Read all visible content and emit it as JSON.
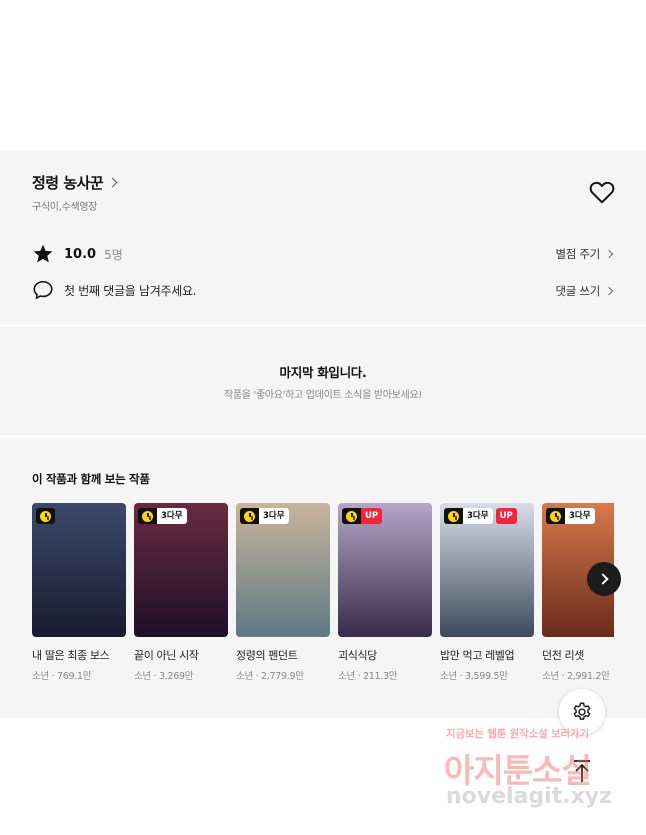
{
  "work": {
    "title": "정령 농사꾼",
    "authors": "구식이,수색영장",
    "rating": "10.0",
    "rating_count": "5명",
    "rate_link": "별점 주기",
    "comment_prompt": "첫 번째 댓글을 남겨주세요.",
    "comment_link": "댓글 쓰기"
  },
  "last_episode": {
    "title": "마지막 화입니다.",
    "subtitle": "작품을 '좋아요'하고 업데이트 소식을 받아보세요!"
  },
  "recommendations": {
    "heading": "이 작품과 함께 보는 작품",
    "items": [
      {
        "title": "내 딸은 최종 보스",
        "meta": "소년 · 769.1만",
        "badge": "",
        "bg_top": "#3a4a6a",
        "bg_bottom": "#1a1a2e"
      },
      {
        "title": "끝이 아닌 시작",
        "meta": "소년 · 3,269만",
        "badge": "3다무",
        "bg_top": "#6a2a40",
        "bg_bottom": "#1c1028"
      },
      {
        "title": "정령의 펜던트",
        "meta": "소년 · 2,779.9만",
        "badge": "3다무",
        "bg_top": "#c8b49a",
        "bg_bottom": "#5d7a86"
      },
      {
        "title": "괴식식당",
        "meta": "소년 · 211.3만",
        "badge": "UP",
        "bg_top": "#b4a6c8",
        "bg_bottom": "#3a2a4a"
      },
      {
        "title": "밥만 먹고 레벨업",
        "meta": "소년 · 3,599.5만",
        "badge2": "UP",
        "badge": "3다무",
        "bg_top": "#d8dde8",
        "bg_bottom": "#3c4a5c"
      },
      {
        "title": "던전 리셋",
        "meta": "소년 · 2,991.2만",
        "badge": "3다무",
        "bg_top": "#d87a4a",
        "bg_bottom": "#6a2a1a"
      }
    ]
  },
  "watermark": {
    "line1": "지금보는 웹툰 원작소설 보러가기",
    "line2": "아지툰소설",
    "line3": "novelagit.xyz"
  }
}
